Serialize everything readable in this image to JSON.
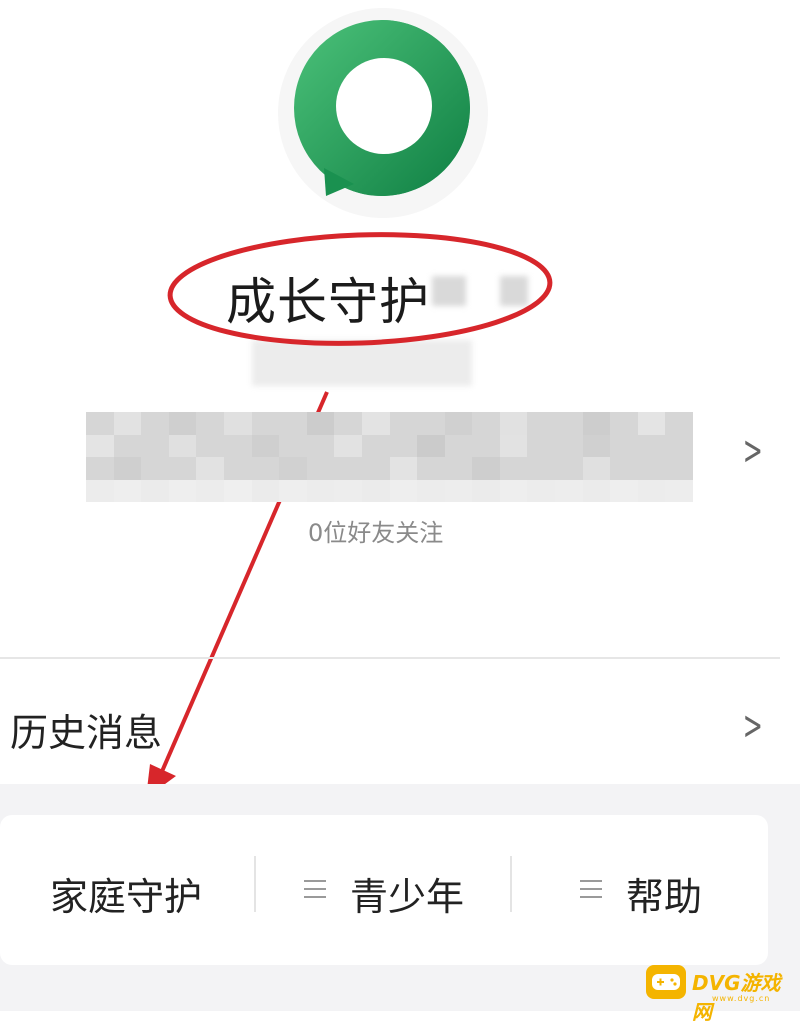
{
  "profile": {
    "title": "成长守护",
    "follow_text": "0位好友关注"
  },
  "menu": {
    "history_label": "历史消息"
  },
  "tabs": [
    {
      "label": "家庭守护"
    },
    {
      "label": "青少年"
    },
    {
      "label": "帮助"
    }
  ],
  "watermark": {
    "text": "DVG游戏网",
    "sub": "www.dvg.cn"
  },
  "colors": {
    "logo_green": "#1f9d55",
    "annotation_red": "#d7262b",
    "watermark_yellow": "#f4b400"
  }
}
